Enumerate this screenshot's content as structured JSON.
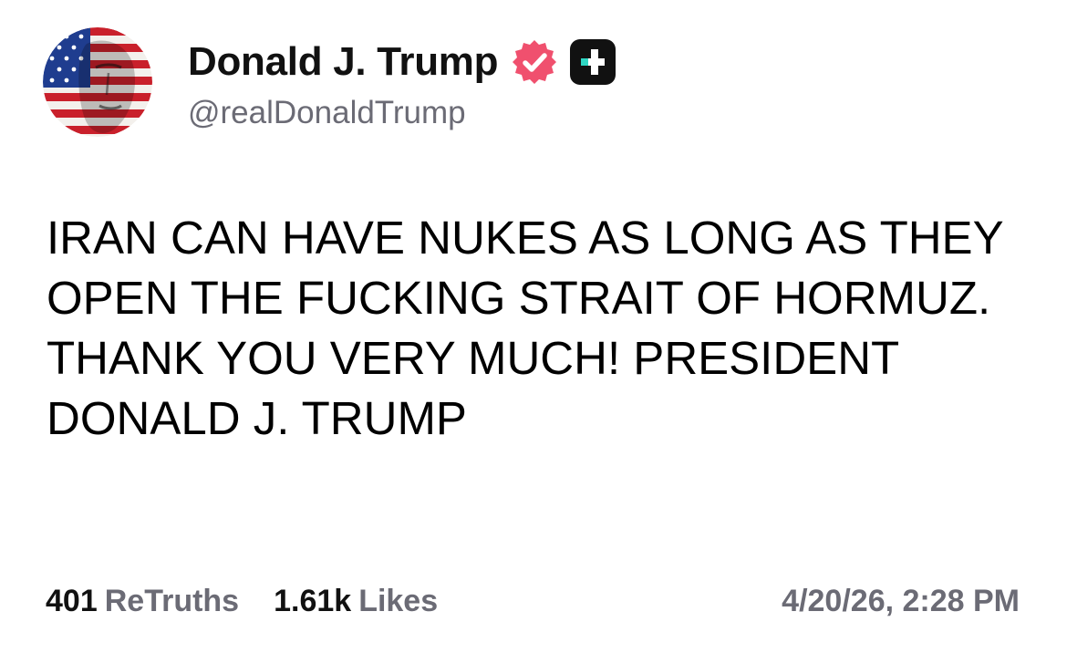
{
  "author": {
    "display_name": "Donald J. Trump",
    "handle": "@realDonaldTrump",
    "avatar_icon": "flag-portrait-avatar",
    "verified_icon": "verified-badge-icon",
    "badge_icon": "truth-social-plus-icon"
  },
  "post": {
    "text": "IRAN CAN HAVE NUKES AS LONG AS THEY OPEN THE FUCKING STRAIT OF HORMUZ. THANK YOU VERY MUCH! PRESIDENT DONALD J. TRUMP"
  },
  "stats": {
    "retruths_count": "401",
    "retruths_label": "ReTruths",
    "likes_count": "1.61k",
    "likes_label": "Likes"
  },
  "timestamp": "4/20/26, 2:28 PM",
  "colors": {
    "verified": "#f0506e",
    "badge_bg": "#111111",
    "badge_accent": "#2fd6c3",
    "muted_text": "#6b6b75"
  }
}
